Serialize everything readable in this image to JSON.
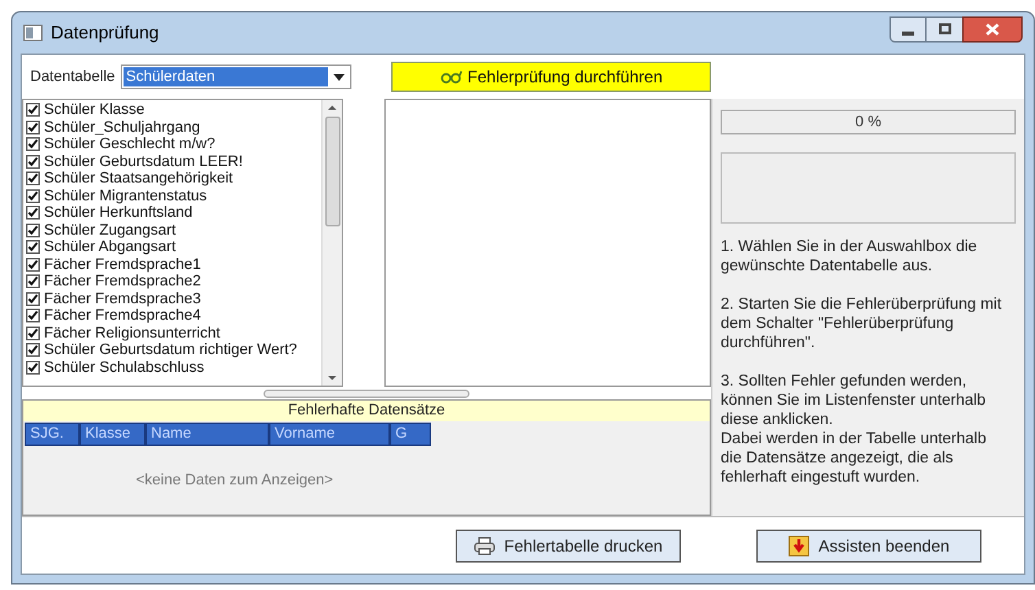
{
  "window": {
    "title": "Datenprüfung"
  },
  "table_select": {
    "label": "Datentabelle",
    "value": "Schülerdaten"
  },
  "check_button": {
    "label": "Fehlerprüfung durchführen"
  },
  "fields": [
    {
      "label": "Schüler Klasse",
      "checked": true
    },
    {
      "label": "Schüler_Schuljahrgang",
      "checked": true
    },
    {
      "label": "Schüler Geschlecht m/w?",
      "checked": true
    },
    {
      "label": "Schüler Geburtsdatum LEER!",
      "checked": true
    },
    {
      "label": "Schüler Staatsangehörigkeit",
      "checked": true
    },
    {
      "label": "Schüler Migrantenstatus",
      "checked": true
    },
    {
      "label": "Schüler Herkunftsland",
      "checked": true
    },
    {
      "label": "Schüler Zugangsart",
      "checked": true
    },
    {
      "label": "Schüler Abgangsart",
      "checked": true
    },
    {
      "label": "Fächer Fremdsprache1",
      "checked": true
    },
    {
      "label": "Fächer Fremdsprache2",
      "checked": true
    },
    {
      "label": "Fächer Fremdsprache3",
      "checked": true
    },
    {
      "label": "Fächer Fremdsprache4",
      "checked": true
    },
    {
      "label": "Fächer Religionsunterricht",
      "checked": true
    },
    {
      "label": "Schüler Geburtsdatum richtiger Wert?",
      "checked": true
    },
    {
      "label": "Schüler Schulabschluss",
      "checked": true
    }
  ],
  "errors_table": {
    "title": "Fehlerhafte Datensätze",
    "columns": [
      "SJG.",
      "Klasse",
      "Name",
      "Vorname",
      "G"
    ],
    "empty_text": "<keine Daten zum Anzeigen>"
  },
  "progress": {
    "level": 0,
    "reading": "0 %"
  },
  "instructions": [
    "1. Wählen Sie in der Auswahlbox die gewünschte Datentabelle aus.",
    "2. Starten Sie die Fehlerüberprüfung mit dem Schalter \"Fehlerüberprüfung durchführen\".",
    "3. Sollten Fehler gefunden werden, können Sie im Listenfenster unterhalb diese anklicken.\nDabei werden in der Tabelle unterhalb die Datensätze angezeigt, die als fehlerhaft eingestuft wurden."
  ],
  "buttons": [
    {
      "kind": "print",
      "label": "Fehlertabelle drucken"
    },
    {
      "kind": "exit",
      "label": "Assisten beenden"
    }
  ]
}
